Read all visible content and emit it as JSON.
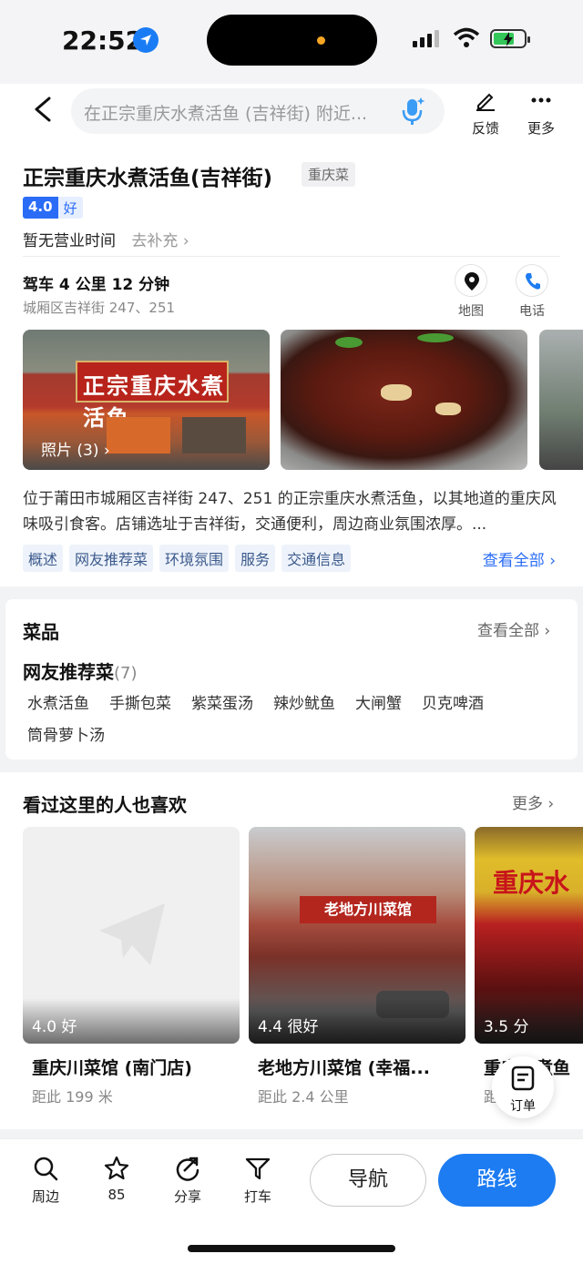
{
  "status_bar": {
    "time": "22:52"
  },
  "header": {
    "search_placeholder": "在正宗重庆水煮活鱼 (吉祥街) 附近...",
    "feedback_label": "反馈",
    "more_label": "更多"
  },
  "poi": {
    "name": "正宗重庆水煮活鱼(吉祥街)",
    "cuisine": "重庆菜",
    "rating": "4.0",
    "rating_word": "好",
    "hours": "暂无营业时间",
    "hours_supplement": "去补充",
    "drive_info": "驾车 4 公里 12 分钟",
    "address": "城厢区吉祥街 247、251",
    "map_label": "地图",
    "phone_label": "电话",
    "photo_sign": "正宗重庆水煮活鱼",
    "photo_label": "照片 (3)",
    "description": "位于莆田市城厢区吉祥街 247、251 的正宗重庆水煮活鱼，以其地道的重庆风味吸引食客。店铺选址于吉祥街，交通便利，周边商业氛围浓厚。...",
    "tags": [
      "概述",
      "网友推荐菜",
      "环境氛围",
      "服务",
      "交通信息"
    ],
    "see_all": "查看全部"
  },
  "dishes": {
    "title": "菜品",
    "see_all": "查看全部",
    "recommend_title": "网友推荐菜",
    "recommend_count": "(7)",
    "items": [
      "水煮活鱼",
      "手撕包菜",
      "紫菜蛋汤",
      "辣炒鱿鱼",
      "大闸蟹",
      "贝克啤酒",
      "筒骨萝卜汤"
    ]
  },
  "also_like": {
    "title": "看过这里的人也喜欢",
    "more": "更多",
    "items": [
      {
        "score": "4.0 好",
        "name": "重庆川菜馆 (南门店)",
        "distance": "距此 199 米"
      },
      {
        "score": "4.4 很好",
        "name": "老地方川菜馆 (幸福...",
        "distance": "距此 2.4 公里"
      },
      {
        "score": "3.5 分",
        "name": "重庆水煮鱼",
        "distance": "距此 里"
      }
    ],
    "photo2_sign": "老地方川菜馆",
    "photo3_sign": "重庆水"
  },
  "order_fab": {
    "label": "订单"
  },
  "bottom_bar": {
    "nearby": "周边",
    "favorites_count": "85",
    "share": "分享",
    "taxi": "打车",
    "navigate": "导航",
    "route": "路线"
  }
}
